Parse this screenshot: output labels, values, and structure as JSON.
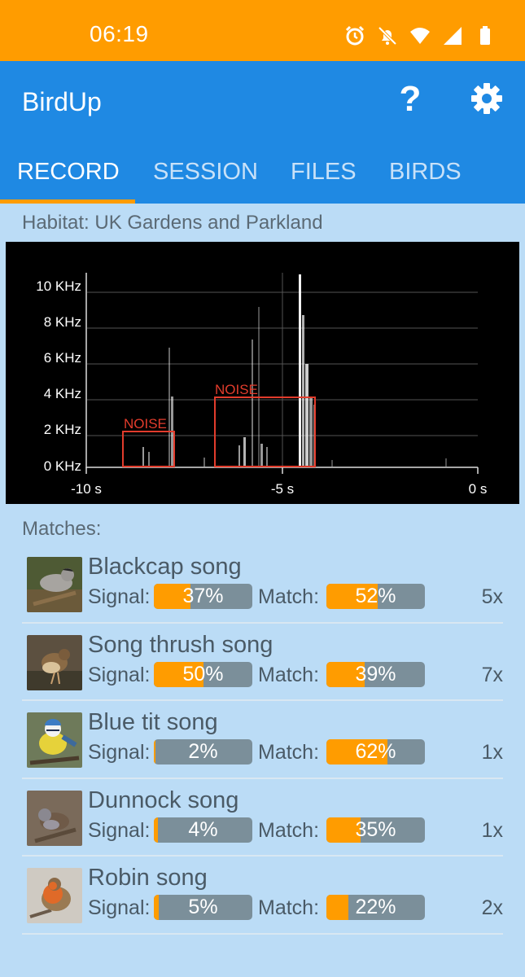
{
  "status": {
    "time": "06:19"
  },
  "app": {
    "title": "BirdUp",
    "help": "?"
  },
  "tabs": [
    {
      "label": "RECORD",
      "active": true
    },
    {
      "label": "SESSION"
    },
    {
      "label": "FILES"
    },
    {
      "label": "BIRDS"
    }
  ],
  "habitat": "Habitat: UK Gardens and Parkland",
  "spectrogram": {
    "y_ticks": [
      "10 KHz",
      "8 KHz",
      "6 KHz",
      "4 KHz",
      "2 KHz",
      "0 KHz"
    ],
    "x_ticks": [
      "-10 s",
      "-5 s",
      "0 s"
    ],
    "noise_label_1": "NOISE",
    "noise_label_2": "NOISE",
    "accent": "#e23c2c"
  },
  "matches_label": "Matches:",
  "matches": [
    {
      "name": "Blackcap song",
      "signal_label": "Signal:",
      "signal": "37%",
      "match_label": "Match:",
      "match": "52%",
      "count": "5x"
    },
    {
      "name": "Song thrush song",
      "signal_label": "Signal:",
      "signal": "50%",
      "match_label": "Match:",
      "match": "39%",
      "count": "7x"
    },
    {
      "name": "Blue tit song",
      "signal_label": "Signal:",
      "signal": "2%",
      "match_label": "Match:",
      "match": "62%",
      "count": "1x"
    },
    {
      "name": "Dunnock song",
      "signal_label": "Signal:",
      "signal": "4%",
      "match_label": "Match:",
      "match": "35%",
      "count": "1x"
    },
    {
      "name": "Robin song",
      "signal_label": "Signal:",
      "signal": "5%",
      "match_label": "Match:",
      "match": "22%",
      "count": "2x"
    }
  ],
  "colors": {
    "status_bar": "#ff9c00",
    "app_bar": "#1f89e3",
    "background": "#bbdcf6",
    "bar_fill": "#ff9c00",
    "bar_track": "#7b8f9a"
  }
}
